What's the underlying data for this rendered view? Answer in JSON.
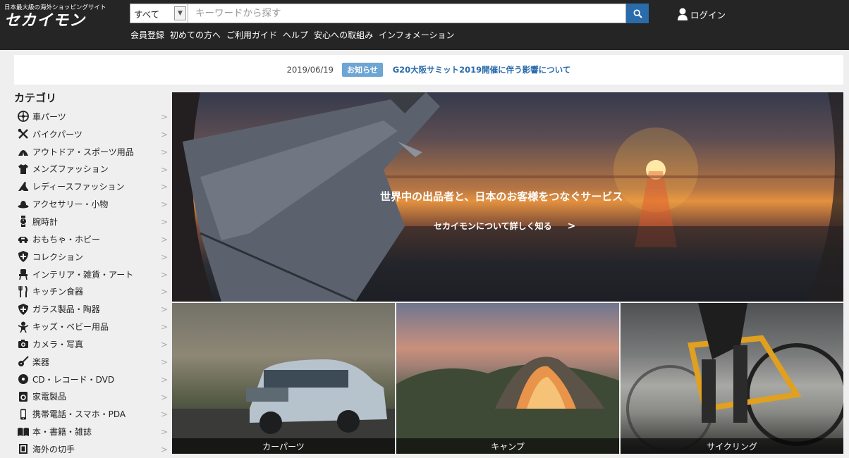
{
  "header": {
    "logo_tagline": "日本最大級の海外ショッピングサイト",
    "logo_text": "セカイモン",
    "search": {
      "category_selected": "すべて",
      "placeholder": "キーワードから探す",
      "button_icon": "search-icon"
    },
    "login_label": "ログイン",
    "nav_links": [
      "会員登録",
      "初めての方へ",
      "ご利用ガイド",
      "ヘルプ",
      "安心への取組み",
      "インフォメーション"
    ]
  },
  "notice": {
    "date": "2019/06/19",
    "badge": "お知らせ",
    "title": "G20大阪サミット2019開催に伴う影響について"
  },
  "sidebar": {
    "title": "カテゴリ",
    "items": [
      {
        "label": "車パーツ",
        "icon": "wheel-icon"
      },
      {
        "label": "バイクパーツ",
        "icon": "tools-icon"
      },
      {
        "label": "アウトドア・スポーツ用品",
        "icon": "tent-icon"
      },
      {
        "label": "メンズファッション",
        "icon": "tshirt-icon"
      },
      {
        "label": "レディースファッション",
        "icon": "heel-icon"
      },
      {
        "label": "アクセサリー・小物",
        "icon": "hat-icon"
      },
      {
        "label": "腕時計",
        "icon": "watch-icon"
      },
      {
        "label": "おもちゃ・ホビー",
        "icon": "toy-car-icon"
      },
      {
        "label": "コレクション",
        "icon": "shield-icon"
      },
      {
        "label": "インテリア・雑貨・アート",
        "icon": "chair-icon"
      },
      {
        "label": "キッチン食器",
        "icon": "cutlery-icon"
      },
      {
        "label": "ガラス製品・陶器",
        "icon": "shield-icon"
      },
      {
        "label": "キッズ・ベビー用品",
        "icon": "baby-icon"
      },
      {
        "label": "カメラ・写真",
        "icon": "camera-icon"
      },
      {
        "label": "楽器",
        "icon": "guitar-icon"
      },
      {
        "label": "CD・レコード・DVD",
        "icon": "disc-icon"
      },
      {
        "label": "家電製品",
        "icon": "washer-icon"
      },
      {
        "label": "携帯電話・スマホ・PDA",
        "icon": "phone-icon"
      },
      {
        "label": "本・書籍・雑誌",
        "icon": "book-icon"
      },
      {
        "label": "海外の切手",
        "icon": "stamp-icon"
      }
    ]
  },
  "hero": {
    "headline": "世界中の出品者と、日本のお客様をつなぐサービス",
    "link_label": "セカイモンについて詳しく知る",
    "link_chevron": ">"
  },
  "tiles": [
    {
      "label": "カーパーツ"
    },
    {
      "label": "キャンプ"
    },
    {
      "label": "サイクリング"
    }
  ],
  "colors": {
    "header_bg": "#252525",
    "accent_blue": "#2a6bab",
    "badge_blue": "#6da5d4"
  }
}
